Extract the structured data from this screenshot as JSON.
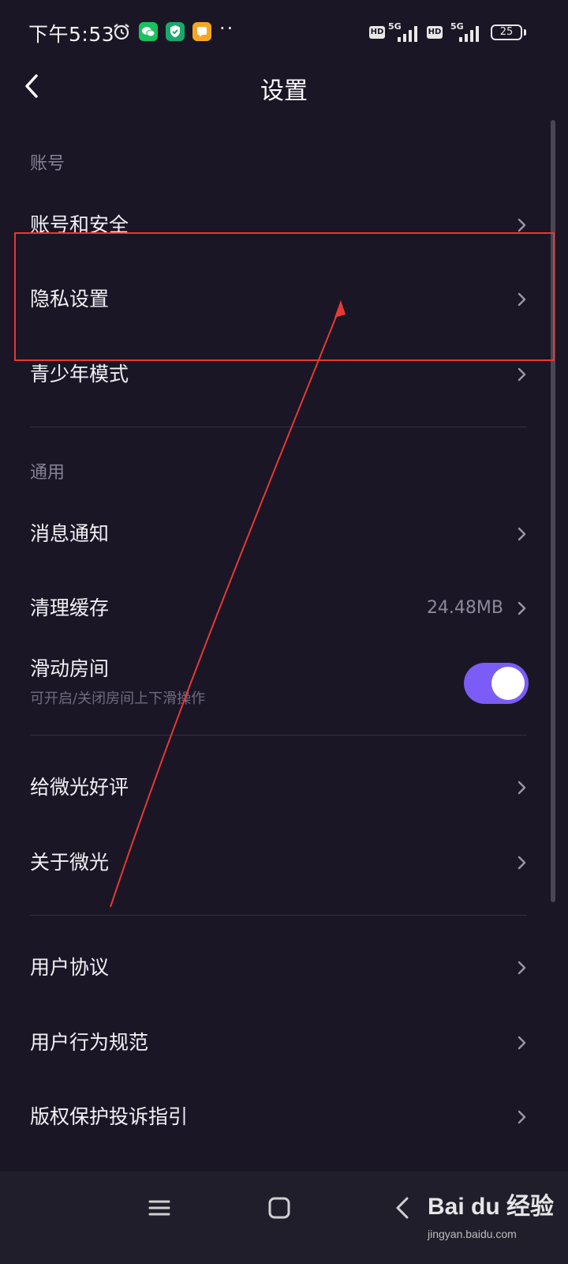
{
  "status_bar": {
    "time": "下午5:53",
    "hd1": "HD",
    "net1": "5G",
    "hd2": "HD",
    "net2": "5G",
    "dots": "··",
    "battery": "25"
  },
  "header": {
    "title": "设置",
    "back_icon": "chevron-left-icon"
  },
  "sections": {
    "account": {
      "header": "账号",
      "items": [
        {
          "label": "账号和安全"
        },
        {
          "label": "隐私设置"
        },
        {
          "label": "青少年模式"
        }
      ]
    },
    "general": {
      "header": "通用",
      "items": [
        {
          "label": "消息通知"
        },
        {
          "label": "清理缓存",
          "value": "24.48MB"
        },
        {
          "label": "滑动房间",
          "subtitle": "可开启/关闭房间上下滑操作",
          "toggle_on": true
        }
      ]
    },
    "about": {
      "items": [
        {
          "label": "给微光好评"
        },
        {
          "label": "关于微光"
        }
      ]
    },
    "legal": {
      "items": [
        {
          "label": "用户协议"
        },
        {
          "label": "用户行为规范"
        },
        {
          "label": "版权保护投诉指引"
        }
      ]
    }
  },
  "watermark": {
    "text": "Bai du 经验",
    "sub": "jingyan.baidu.com"
  },
  "colors": {
    "background": "#1a1625",
    "toggle_on": "#7b5cf6",
    "annotation": "#e53935"
  }
}
